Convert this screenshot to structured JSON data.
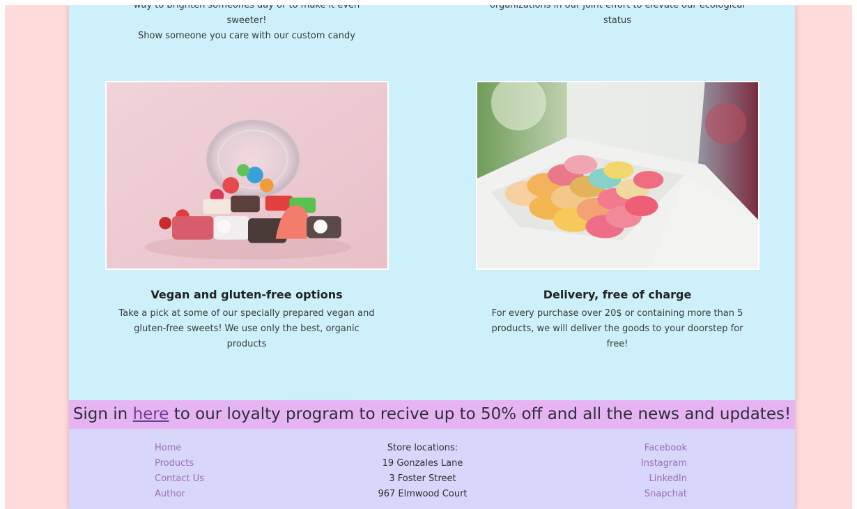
{
  "features_top": {
    "left": {
      "desc_line1": "way to brighten someones day or to make it even sweeter!",
      "desc_line2": "Show someone you care with our custom candy"
    },
    "right": {
      "desc_line1": "organizations in our joint effort to elevate our ecological",
      "desc_line2": "status"
    }
  },
  "features": [
    {
      "title": "Vegan and gluten-free options",
      "desc_line1": "Take a pick at some of our specially prepared vegan and",
      "desc_line2": "gluten-free sweets! We use only the best, organic products"
    },
    {
      "title": "Delivery, free of charge",
      "desc_line1": "For every purchase over 20$ or containing more than 5",
      "desc_line2": "products, we will deliver the goods to your doorstep for",
      "desc_line3": "free!"
    }
  ],
  "promo": {
    "prefix": "Sign in ",
    "link": "here",
    "suffix": " to our loyalty program to recive up to 50% off and all the news and updates!"
  },
  "footer": {
    "nav": [
      "Home",
      "Products",
      "Contact Us",
      "Author"
    ],
    "stores_title": "Store locations:",
    "stores": [
      "19 Gonzales Lane",
      "3 Foster Street",
      "967 Elmwood Court"
    ],
    "social": [
      "Facebook",
      "Instagram",
      "LinkedIn",
      "Snapchat"
    ]
  },
  "colors": {
    "outer_background": "#ffdcdc",
    "content_background": "#cdf0fa",
    "promo_background": "#e6b4f2",
    "footer_background": "#d9d6fc",
    "link": "#9a6fb3"
  }
}
